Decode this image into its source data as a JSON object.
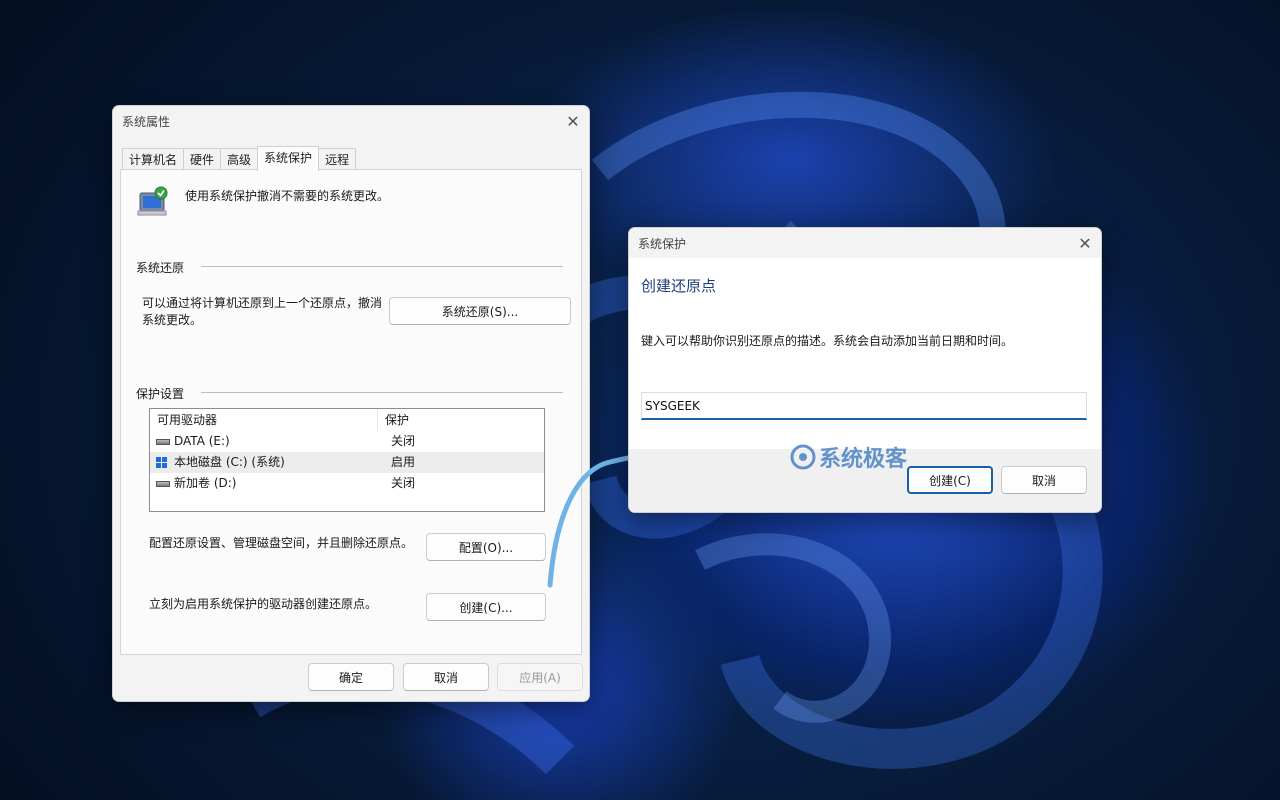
{
  "system_properties": {
    "title": "系统属性",
    "tabs": [
      {
        "label": "计算机名"
      },
      {
        "label": "硬件"
      },
      {
        "label": "高级"
      },
      {
        "label": "系统保护",
        "active": true
      },
      {
        "label": "远程"
      }
    ],
    "intro": "使用系统保护撤消不需要的系统更改。",
    "restore_group": "系统还原",
    "restore_desc": "可以通过将计算机还原到上一个还原点，撤消系统更改。",
    "restore_button": "系统还原(S)...",
    "protection_group": "保护设置",
    "drive_list": {
      "headers": [
        "可用驱动器",
        "保护"
      ],
      "rows": [
        {
          "name": "DATA (E:)",
          "protection": "关闭",
          "icon": "hdd-icon"
        },
        {
          "name": "本地磁盘 (C:) (系统)",
          "protection": "启用",
          "icon": "windows-drive-icon"
        },
        {
          "name": "新加卷 (D:)",
          "protection": "关闭",
          "icon": "hdd-icon"
        }
      ]
    },
    "configure_desc": "配置还原设置、管理磁盘空间，并且删除还原点。",
    "configure_button": "配置(O)...",
    "create_desc": "立刻为启用系统保护的驱动器创建还原点。",
    "create_button": "创建(C)...",
    "ok_button": "确定",
    "cancel_button": "取消",
    "apply_button": "应用(A)"
  },
  "dialog": {
    "title": "系统保护",
    "heading": "创建还原点",
    "description": "键入可以帮助你识别还原点的描述。系统会自动添加当前日期和时间。",
    "input_value": "SYSGEEK",
    "create_button": "创建(C)",
    "cancel_button": "取消"
  },
  "watermark": {
    "text": "系统极客"
  },
  "colors": {
    "accent": "#1c5fa6",
    "arrow": "#6fb3e6"
  }
}
